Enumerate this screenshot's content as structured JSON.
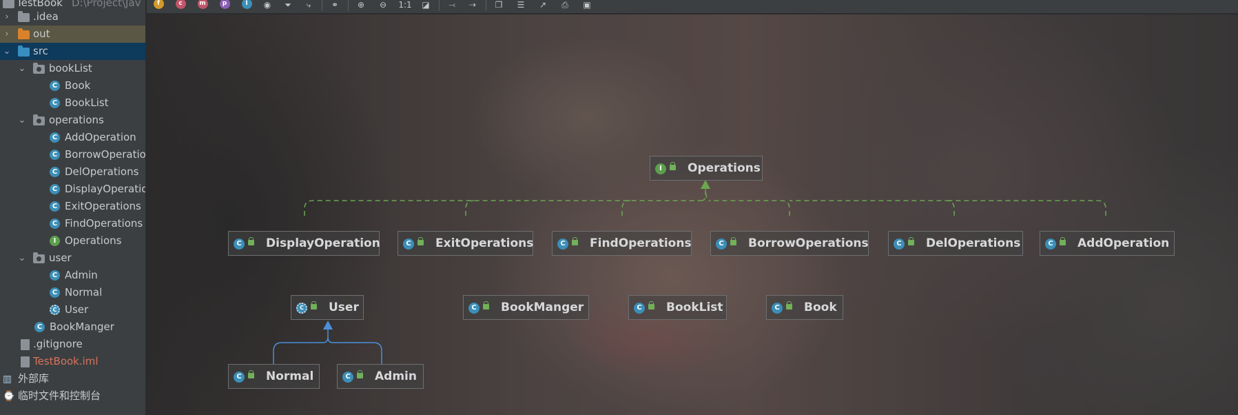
{
  "tree": {
    "items": [
      {
        "label": "TestBook",
        "suffix": "D:\\Project\\Jav"
      },
      {
        "label": ".idea"
      },
      {
        "label": "out"
      },
      {
        "label": "src"
      },
      {
        "label": "bookList"
      },
      {
        "label": "Book"
      },
      {
        "label": "BookList"
      },
      {
        "label": "operations"
      },
      {
        "label": "AddOperation"
      },
      {
        "label": "BorrowOperatio"
      },
      {
        "label": "DelOperations"
      },
      {
        "label": "DisplayOperatio"
      },
      {
        "label": "ExitOperations"
      },
      {
        "label": "FindOperations"
      },
      {
        "label": "Operations"
      },
      {
        "label": "user"
      },
      {
        "label": "Admin"
      },
      {
        "label": "Normal"
      },
      {
        "label": "User"
      },
      {
        "label": "BookManger"
      },
      {
        "label": ".gitignore"
      },
      {
        "label": "TestBook.iml"
      },
      {
        "label": "外部库"
      },
      {
        "label": "临时文件和控制台"
      }
    ]
  },
  "toolbar": {
    "icons": [
      "field-filter-icon",
      "constructor-filter-icon",
      "method-filter-icon",
      "property-filter-icon",
      "inner-class-filter-icon",
      "show-icon",
      "filter-icon",
      "edge-icon",
      "link-icon",
      "zoom-in-icon",
      "zoom-out-icon",
      "actual-size-icon",
      "fit-content-icon",
      "layout-icon",
      "route-icon",
      "copy-icon",
      "export-icon",
      "open-icon",
      "print-icon",
      "save-icon"
    ],
    "actual_size_label": "1:1"
  },
  "diagram": {
    "nodes": [
      {
        "name": "Operations",
        "kind": "interface"
      },
      {
        "name": "DisplayOperation",
        "kind": "class"
      },
      {
        "name": "ExitOperations",
        "kind": "class"
      },
      {
        "name": "FindOperations",
        "kind": "class"
      },
      {
        "name": "BorrowOperations",
        "kind": "class"
      },
      {
        "name": "DelOperations",
        "kind": "class"
      },
      {
        "name": "AddOperation",
        "kind": "class"
      },
      {
        "name": "User",
        "kind": "abstract"
      },
      {
        "name": "BookManger",
        "kind": "class"
      },
      {
        "name": "BookList",
        "kind": "class"
      },
      {
        "name": "Book",
        "kind": "class"
      },
      {
        "name": "Normal",
        "kind": "class"
      },
      {
        "name": "Admin",
        "kind": "class"
      }
    ],
    "colors": {
      "implements_edge": "#6aa84f",
      "extends_edge": "#4a90d9",
      "class_icon": "#3b8fb8",
      "interface_icon": "#5c9f4c"
    }
  }
}
